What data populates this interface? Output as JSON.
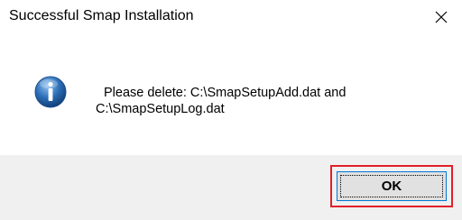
{
  "window": {
    "title": "Successful Smap Installation",
    "close_icon": "close-icon"
  },
  "message": {
    "icon": "info-icon",
    "line1": "Please delete: C:\\SmapSetupAdd.dat and",
    "line2": "C:\\SmapSetupLog.dat"
  },
  "footer": {
    "ok_label": "OK"
  },
  "colors": {
    "footer_bg": "#f0f0f0",
    "button_border": "#0078d7",
    "highlight": "#e0202a",
    "icon_blue": "#2d6fb7"
  }
}
